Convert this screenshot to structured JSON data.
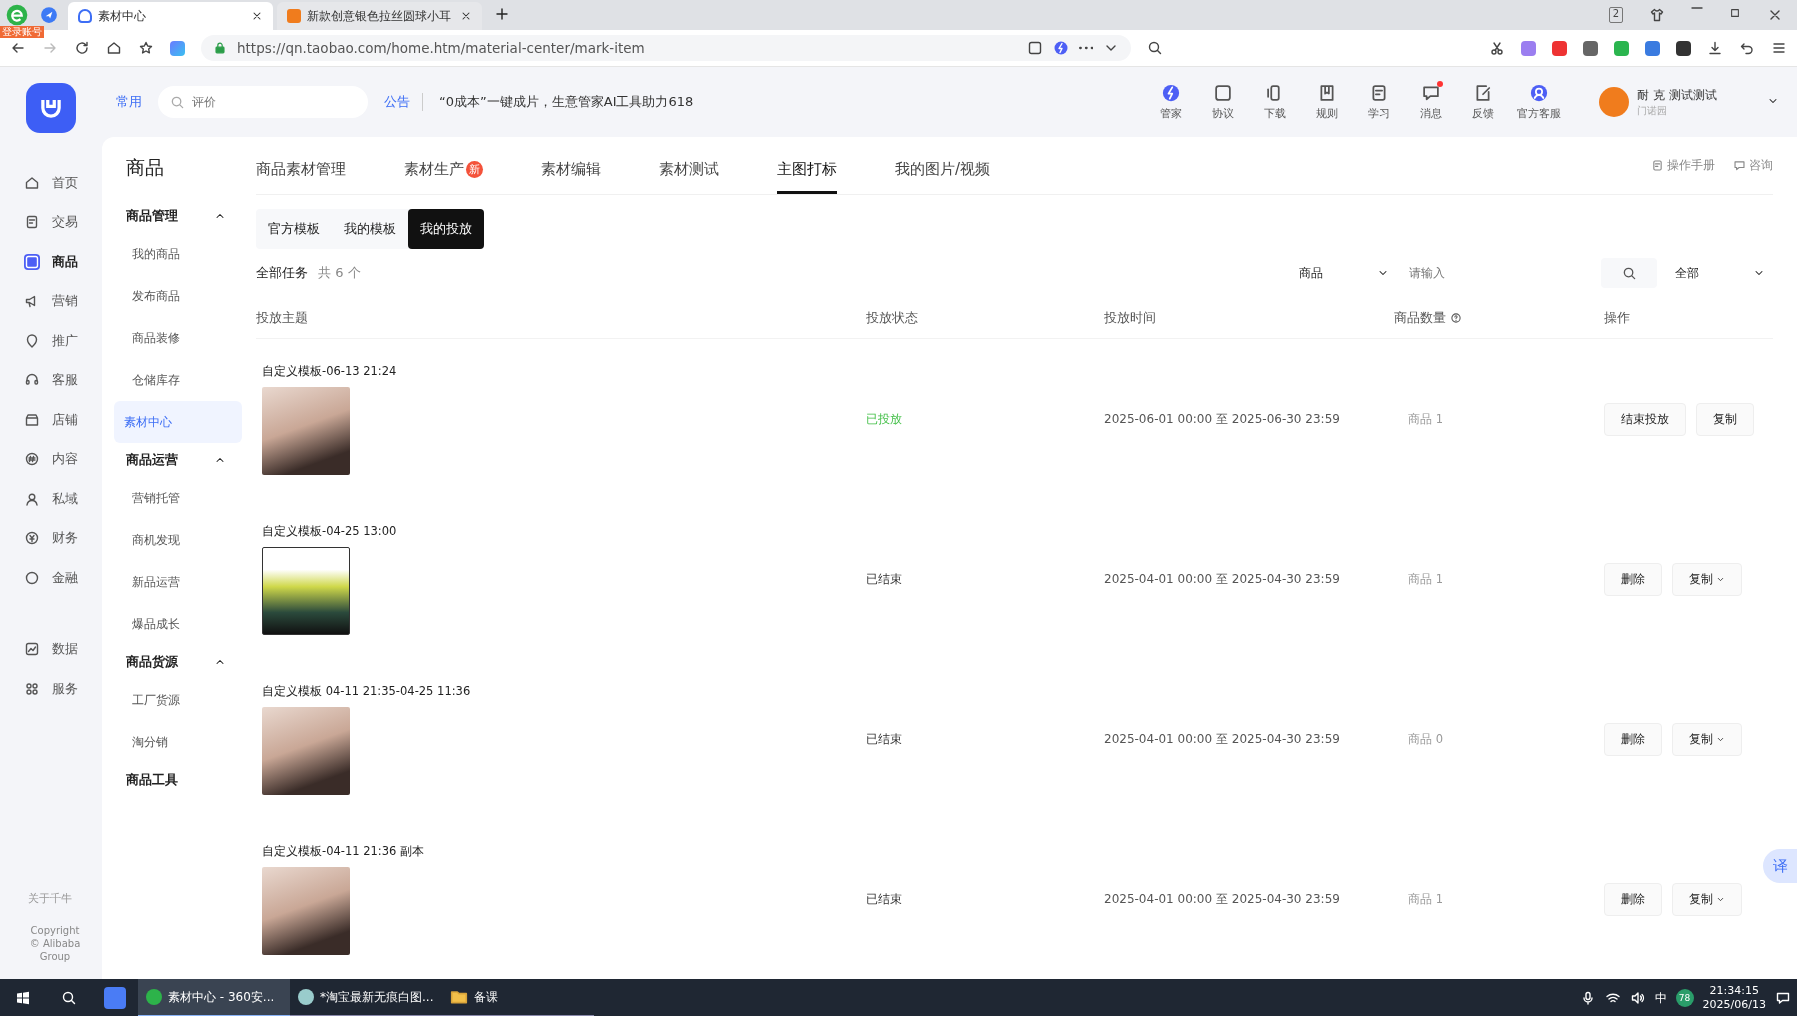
{
  "browser": {
    "badge": "登录账号",
    "tabs": [
      {
        "title": "素材中心",
        "selected": true
      },
      {
        "title": "新款创意银色拉丝圆球小耳",
        "selected": false
      }
    ],
    "tab_count": "2",
    "url": "https://qn.taobao.com/home.htm/material-center/mark-item"
  },
  "header": {
    "frequent": "常用",
    "search_placeholder": "评价",
    "notice_label": "公告",
    "notice": "“0成本”一键成片，生意管家AI工具助力618",
    "tools": [
      {
        "label": "管家",
        "unread": false
      },
      {
        "label": "协议",
        "unread": false
      },
      {
        "label": "下载",
        "unread": false
      },
      {
        "label": "规则",
        "unread": false
      },
      {
        "label": "学习",
        "unread": false
      },
      {
        "label": "消息",
        "unread": true
      },
      {
        "label": "反馈",
        "unread": false
      },
      {
        "label": "官方客服",
        "unread": false
      }
    ],
    "user": {
      "name": "耐 克 测试测试",
      "sub": "门诺园"
    }
  },
  "nav": {
    "items": [
      {
        "label": "首页",
        "selected": false
      },
      {
        "label": "交易",
        "selected": false
      },
      {
        "label": "商品",
        "selected": true
      },
      {
        "label": "营销",
        "selected": false
      },
      {
        "label": "推广",
        "selected": false
      },
      {
        "label": "客服",
        "selected": false
      },
      {
        "label": "店铺",
        "selected": false
      },
      {
        "label": "内容",
        "selected": false
      },
      {
        "label": "私域",
        "selected": false
      },
      {
        "label": "财务",
        "selected": false
      },
      {
        "label": "金融",
        "selected": false
      }
    ],
    "bottom_items": [
      {
        "label": "数据",
        "selected": false
      },
      {
        "label": "服务",
        "selected": false
      }
    ],
    "about": "关于千牛",
    "copyright": "Copyright © Alibaba Group"
  },
  "sidebar": {
    "title": "商品",
    "groups": [
      {
        "label": "商品管理",
        "expanded": true,
        "items": [
          {
            "label": "我的商品",
            "selected": false
          },
          {
            "label": "发布商品",
            "selected": false
          },
          {
            "label": "商品装修",
            "selected": false
          },
          {
            "label": "仓储库存",
            "selected": false
          },
          {
            "label": "素材中心",
            "selected": true
          }
        ]
      },
      {
        "label": "商品运营",
        "expanded": true,
        "items": [
          {
            "label": "营销托管",
            "selected": false
          },
          {
            "label": "商机发现",
            "selected": false
          },
          {
            "label": "新品运营",
            "selected": false
          },
          {
            "label": "爆品成长",
            "selected": false
          }
        ]
      },
      {
        "label": "商品货源",
        "expanded": true,
        "items": [
          {
            "label": "工厂货源",
            "selected": false
          },
          {
            "label": "淘分销",
            "selected": false
          }
        ]
      }
    ],
    "tools_link": "商品工具"
  },
  "tabs": [
    {
      "label": "商品素材管理",
      "selected": false
    },
    {
      "label": "素材生产",
      "selected": false,
      "badge": "新"
    },
    {
      "label": "素材编辑",
      "selected": false
    },
    {
      "label": "素材测试",
      "selected": false
    },
    {
      "label": "主图打标",
      "selected": true
    },
    {
      "label": "我的图片/视频",
      "selected": false
    }
  ],
  "help_links": [
    "操作手册",
    "咨询"
  ],
  "sub_tabs": [
    {
      "label": "官方模板",
      "selected": false
    },
    {
      "label": "我的模板",
      "selected": false
    },
    {
      "label": "我的投放",
      "selected": true
    }
  ],
  "summary": {
    "label": "全部任务",
    "count": "共 6 个"
  },
  "filters": {
    "type": "商品",
    "placeholder": "请输入",
    "status": "全部"
  },
  "table": {
    "columns": [
      "投放主题",
      "投放状态",
      "投放时间",
      "商品数量",
      "操作"
    ],
    "rows": [
      {
        "title": "自定义模板-06-13 21:24",
        "status": "已投放",
        "kind": "active",
        "time": "2025-06-01 00:00 至 2025-06-30 23:59",
        "count": "商品 1",
        "actions": [
          {
            "label": "结束投放",
            "menu": false
          },
          {
            "label": "复制",
            "menu": false
          }
        ]
      },
      {
        "title": "自定义模板-04-25 13:00",
        "status": "已结束",
        "kind": "ended",
        "time": "2025-04-01 00:00 至 2025-04-30 23:59",
        "count": "商品 1",
        "actions": [
          {
            "label": "删除",
            "menu": false
          },
          {
            "label": "复制",
            "menu": true
          }
        ]
      },
      {
        "title": "自定义模板 04-11 21:35-04-25 11:36",
        "status": "已结束",
        "kind": "ended",
        "time": "2025-04-01 00:00 至 2025-04-30 23:59",
        "count": "商品 0",
        "actions": [
          {
            "label": "删除",
            "menu": false
          },
          {
            "label": "复制",
            "menu": true
          }
        ]
      },
      {
        "title": "自定义模板-04-11 21:36 副本",
        "status": "已结束",
        "kind": "ended",
        "time": "2025-04-01 00:00 至 2025-04-30 23:59",
        "count": "商品 1",
        "actions": [
          {
            "label": "删除",
            "menu": false
          },
          {
            "label": "复制",
            "menu": true
          }
        ]
      }
    ]
  },
  "translate_button": "译",
  "taskbar": {
    "items": [
      {
        "label": "素材中心 - 360安...",
        "selected": true
      },
      {
        "label": "*淘宝最新无痕白图...",
        "selected": false
      },
      {
        "label": "备课",
        "selected": false
      }
    ],
    "ime": "中",
    "badge": "78",
    "time": "21:34:15",
    "date": "2025/06/13"
  }
}
